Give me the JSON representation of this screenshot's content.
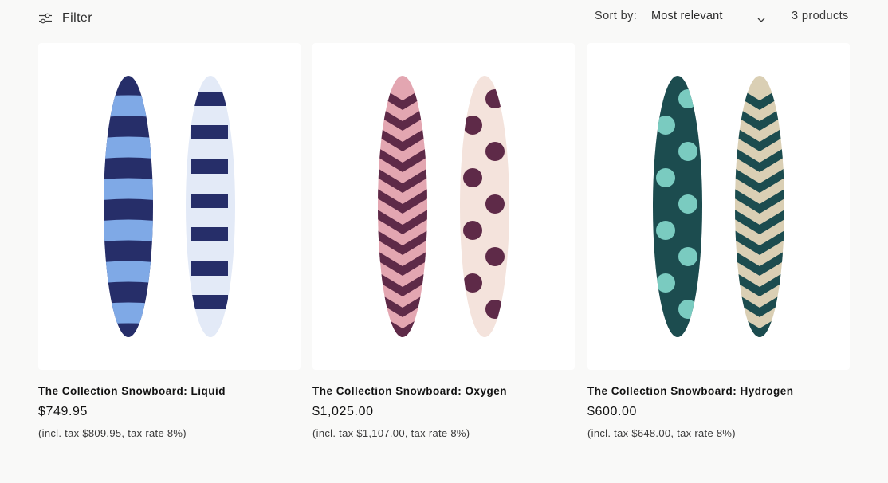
{
  "toolbar": {
    "filter_label": "Filter",
    "sort_label": "Sort by:",
    "sort_value": "Most relevant",
    "product_count": "3 products"
  },
  "products": [
    {
      "title": "The Collection Snowboard: Liquid",
      "price": "$749.95",
      "tax_note": "(incl. tax $809.95, tax rate 8%)",
      "colors": {
        "primary": "#262e69",
        "secondary": "#7fa9e6",
        "alt_base": "#e3eaf7"
      }
    },
    {
      "title": "The Collection Snowboard: Oxygen",
      "price": "$1,025.00",
      "tax_note": "(incl. tax $1,107.00, tax rate 8%)",
      "colors": {
        "primary": "#5e2a48",
        "secondary": "#e3a6b1",
        "alt_base": "#f4e3dc"
      }
    },
    {
      "title": "The Collection Snowboard: Hydrogen",
      "price": "$600.00",
      "tax_note": "(incl. tax $648.00, tax rate 8%)",
      "colors": {
        "primary": "#1c4c4f",
        "secondary": "#7acbc0",
        "alt_base": "#dacfb4"
      }
    }
  ]
}
